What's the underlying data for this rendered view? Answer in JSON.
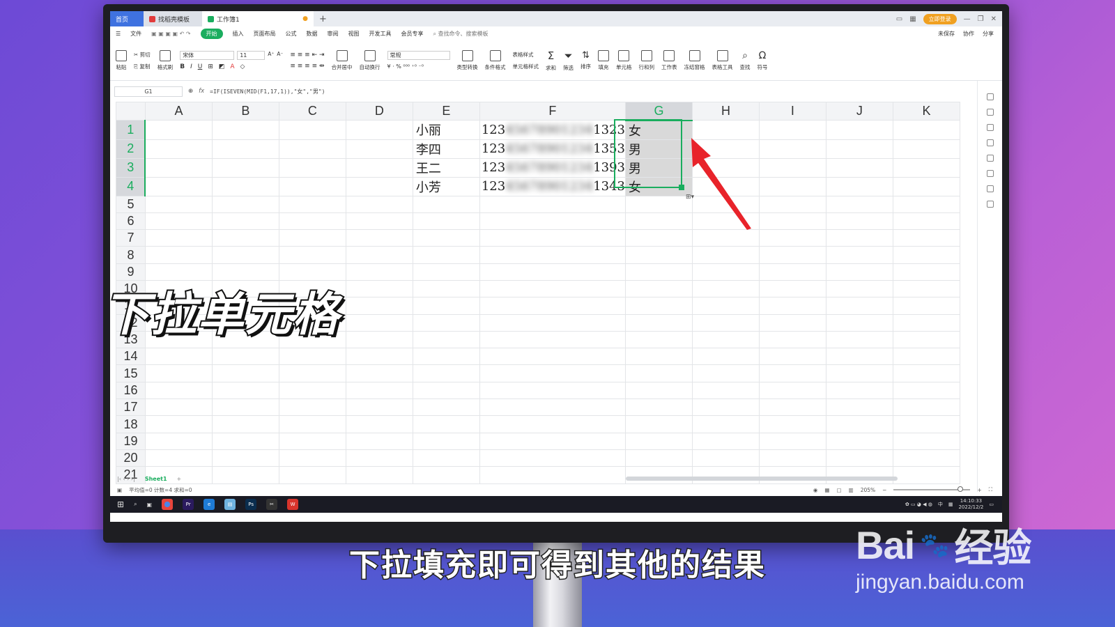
{
  "titlebar": {
    "home_tab": "首页",
    "tab1": "找稻壳模板",
    "tab2": "工作簿1",
    "new_tab": "+",
    "login": "立即登录"
  },
  "menu": {
    "items": [
      "文件",
      "开始",
      "插入",
      "页面布局",
      "公式",
      "数据",
      "审阅",
      "视图",
      "开发工具",
      "会员专享"
    ],
    "active": "开始",
    "search_placeholder": "查找命令、搜索模板",
    "right": [
      "未保存",
      "协作",
      "分享"
    ]
  },
  "ribbon": {
    "paste": "粘贴",
    "cut": "剪切",
    "copy": "复制",
    "format_painter": "格式刷",
    "font": "宋体",
    "size": "11",
    "merge": "合并居中",
    "wrap": "自动换行",
    "number_format": "常规",
    "type_convert": "类型转换",
    "cond_format": "条件格式",
    "table_style": "表格样式",
    "cell_style": "单元格样式",
    "sum": "求和",
    "filter": "筛选",
    "sort": "排序",
    "fill": "填充",
    "cell": "单元格",
    "rowcol": "行和列",
    "sheet": "工作表",
    "freeze": "冻结窗格",
    "table_tools": "表格工具",
    "find": "查找",
    "symbol": "符号"
  },
  "formula_bar": {
    "name_box": "G1",
    "fx": "fx",
    "formula": "=IF(ISEVEN(MID(F1,17,1)),\"女\",\"男\")"
  },
  "grid": {
    "columns": [
      "A",
      "B",
      "C",
      "D",
      "E",
      "F",
      "G",
      "H",
      "I",
      "J",
      "K"
    ],
    "selected_column": "G",
    "rows": [
      "1",
      "2",
      "3",
      "4",
      "5",
      "6",
      "7",
      "8",
      "9",
      "10",
      "11",
      "12",
      "13",
      "14",
      "15",
      "16",
      "17",
      "18",
      "19",
      "20",
      "21"
    ],
    "data": [
      {
        "name": "小丽",
        "id_start": "123",
        "id_mid": "45678901234",
        "id_end": "1323",
        "gender": "女"
      },
      {
        "name": "李四",
        "id_start": "123",
        "id_mid": "45678901234",
        "id_end": "1353",
        "gender": "男"
      },
      {
        "name": "王二",
        "id_start": "123",
        "id_mid": "45678901234",
        "id_end": "1393",
        "gender": "男"
      },
      {
        "name": "小芳",
        "id_start": "123",
        "id_mid": "45678901234",
        "id_end": "1343",
        "gender": "女"
      }
    ]
  },
  "sheet_tabs": {
    "active": "Sheet1",
    "add": "+"
  },
  "status": {
    "summary": "平均值=0  计数=4  求和=0",
    "zoom": "205%"
  },
  "taskbar": {
    "time": "14:10:33",
    "date": "2022/12/2",
    "ime": "中"
  },
  "overlay": {
    "caption": "下拉单元格",
    "subtitle": "下拉填充即可得到其他的结果",
    "watermark_brand": "Bai",
    "watermark_brand2": "经验",
    "watermark_url": "jingyan.baidu.com"
  },
  "colors": {
    "accent_green": "#1aad5e",
    "arrow_red": "#e8232a",
    "home_tab_blue": "#3f72e0"
  }
}
